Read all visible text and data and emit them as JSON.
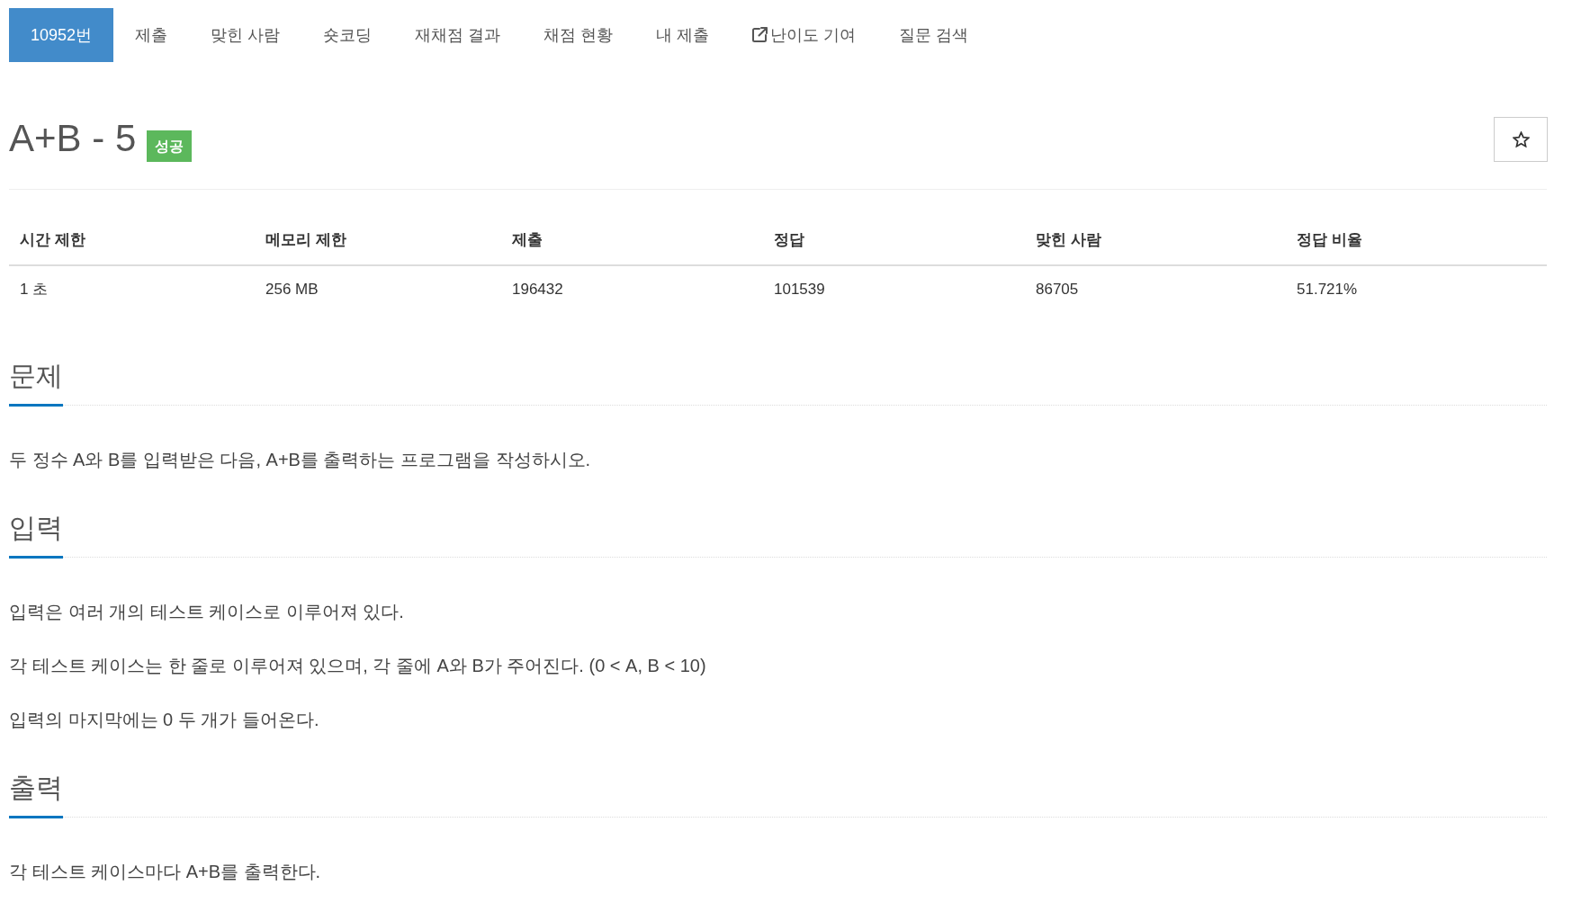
{
  "tabs": [
    {
      "label": "10952번",
      "kind": "link",
      "selected": true
    },
    {
      "label": "제출",
      "kind": "link",
      "selected": false
    },
    {
      "label": "맞힌 사람",
      "kind": "link",
      "selected": false
    },
    {
      "label": "숏코딩",
      "kind": "link",
      "selected": false
    },
    {
      "label": "재채점 결과",
      "kind": "link",
      "selected": false
    },
    {
      "label": "채점 현황",
      "kind": "link",
      "selected": false
    },
    {
      "label": "내 제출",
      "kind": "link",
      "selected": false
    },
    {
      "label": "난이도 기여",
      "kind": "external",
      "selected": false
    },
    {
      "label": "질문 검색",
      "kind": "link",
      "selected": false
    }
  ],
  "problem": {
    "title": "A+B - 5",
    "result": "성공",
    "starred": false
  },
  "info_table": {
    "columns": [
      "시간 제한",
      "메모리 제한",
      "제출",
      "정답",
      "맞힌 사람",
      "정답 비율"
    ],
    "rows": [
      [
        "1 초",
        "256 MB",
        "196432",
        "101539",
        "86705",
        "51.721%"
      ]
    ]
  },
  "sections": [
    {
      "heading": "문제",
      "paragraphs": [
        "두 정수 A와 B를 입력받은 다음, A+B를 출력하는 프로그램을 작성하시오."
      ]
    },
    {
      "heading": "입력",
      "paragraphs": [
        "입력은 여러 개의 테스트 케이스로 이루어져 있다.",
        "각 테스트 케이스는 한 줄로 이루어져 있으며, 각 줄에 A와 B가 주어진다. (0 < A, B < 10)",
        "입력의 마지막에는 0 두 개가 들어온다."
      ]
    },
    {
      "heading": "출력",
      "paragraphs": [
        "각 테스트 케이스마다 A+B를 출력한다."
      ]
    }
  ]
}
